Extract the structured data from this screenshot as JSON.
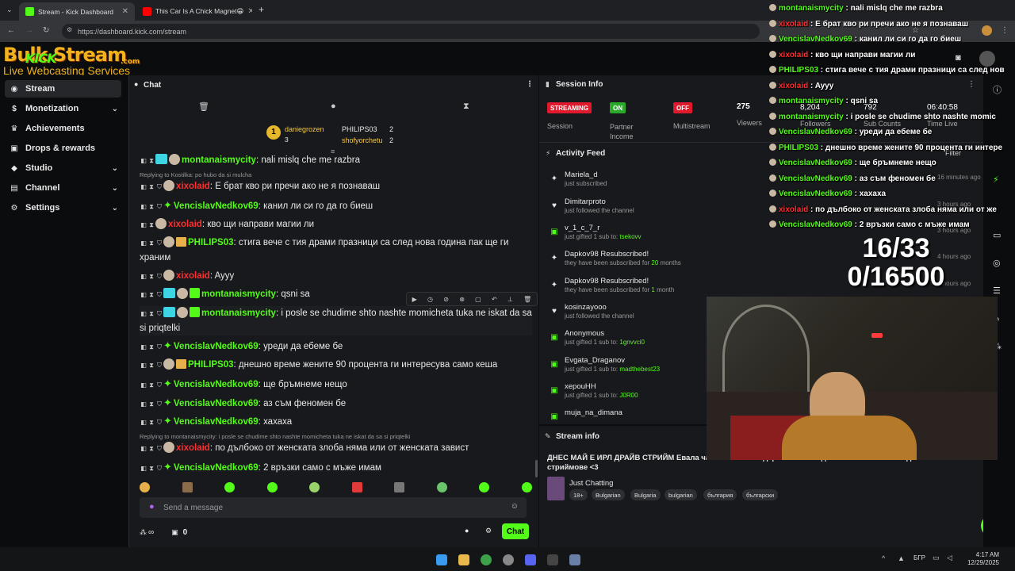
{
  "browser": {
    "tabs": [
      {
        "title": "Stream - Kick Dashboard"
      },
      {
        "title": "This Car Is A Chick Magnet😁"
      }
    ],
    "url": "https://dashboard.kick.com/stream"
  },
  "logo": {
    "text": "Bulk Stream",
    "kick": "KICK",
    "domain": ".com",
    "subtitle": "Live Webcasting Services"
  },
  "sidebar": {
    "items": [
      {
        "label": "Stream"
      },
      {
        "label": "Monetization"
      },
      {
        "label": "Achievements"
      },
      {
        "label": "Drops & rewards"
      },
      {
        "label": "Studio"
      },
      {
        "label": "Channel"
      },
      {
        "label": "Settings"
      }
    ]
  },
  "chat": {
    "title": "Chat",
    "top_gifters": {
      "first": {
        "name": "daniegrozen",
        "count": "3"
      },
      "second": {
        "name": "PHILIPS03",
        "count": "2"
      },
      "third": {
        "name": "shofyorchetu",
        "count": "2"
      },
      "rank": "1"
    },
    "messages": [
      {
        "user": "montanaismycity",
        "text": "nali mislq che me razbra"
      },
      {
        "reply": "Replying to Kostilka: po hubo da si mulcha"
      },
      {
        "user": "xixolaid",
        "text": "Е брат кво ри пречи ако не я познаваш"
      },
      {
        "user": "VencislavNedkov69",
        "text": "канил ли си го да го биеш"
      },
      {
        "user": "xixolaid",
        "text": "кво щи направи магии ли"
      },
      {
        "user": "PHILIPS03",
        "text": "стига вече с тия драми празници са след нова година пак ще ги храним"
      },
      {
        "user": "xixolaid",
        "text": "Ayyy"
      },
      {
        "user": "montanaismycity",
        "text": "qsni sa"
      },
      {
        "user": "montanaismycity",
        "text": "i posle se chudime shto nashte momicheta tuka ne iskat da sa si priqtelki"
      },
      {
        "user": "VencislavNedkov69",
        "text": "уреди да ебеме бе"
      },
      {
        "user": "PHILIPS03",
        "text": "днешно време жените 90 процента ги интересува само кеша"
      },
      {
        "user": "VencislavNedkov69",
        "text": "ще бръмнеме нещо"
      },
      {
        "user": "VencislavNedkov69",
        "text": "аз съм феномен бе"
      },
      {
        "user": "VencislavNedkov69",
        "text": "хахаха"
      },
      {
        "reply": "Replying to montanaismycity: i posle se chudime shto nashte momicheta tuka ne iskat da sa si priqtelki"
      },
      {
        "user": "xixolaid",
        "text": "по дълбоко от женската злоба няма или от женската завист"
      },
      {
        "user": "VencislavNedkov69",
        "text": "2 връзки само с мъже имам"
      }
    ],
    "input_placeholder": "Send a message",
    "footer": {
      "infinity": "∞",
      "count": "0"
    },
    "send_label": "Chat"
  },
  "session": {
    "title": "Session Info",
    "streaming": {
      "status": "STREAMING",
      "label": "Session"
    },
    "partner": {
      "status": "ON",
      "label": "Partner Income"
    },
    "multistream": {
      "status": "OFF",
      "label": "Multistream"
    },
    "viewers": {
      "value": "275",
      "label": "Viewers"
    },
    "followers": {
      "value": "8,204",
      "label": "Followers"
    },
    "subs": {
      "value": "792",
      "label": "Sub Counts"
    },
    "time": {
      "value": "06:40:58",
      "label": "Time Live"
    }
  },
  "activity": {
    "title": "Activity Feed",
    "filter": "Filter",
    "items": [
      {
        "name": "Mariela_d",
        "desc": "just subscribed",
        "time": "16 minutes ago"
      },
      {
        "name": "Dimitarproto",
        "desc": "just followed the channel",
        "time": "3 hours ago"
      },
      {
        "name": "v_1_c_7_r",
        "desc": "just gifted 1 sub to:",
        "target": "tsekovv",
        "time": "3 hours ago"
      },
      {
        "name": "Dapkov98 Resubscribed!",
        "desc": "they have been subscribed for",
        "months": "20",
        "unit": "months",
        "time": "4 hours ago"
      },
      {
        "name": "Dapkov98 Resubscribed!",
        "desc": "they have been subscribed for",
        "months": "1",
        "unit": "month",
        "time": "4 hours ago"
      },
      {
        "name": "kosinzayooo",
        "desc": "just followed the channel",
        "time": ""
      },
      {
        "name": "Anonymous",
        "desc": "just gifted 1 sub to:",
        "target": "1gnvvci0",
        "time": ""
      },
      {
        "name": "Evgata_Draganov",
        "desc": "just gifted 1 sub to:",
        "target": "madthebest23",
        "time": ""
      },
      {
        "name": "xepouHH",
        "desc": "just gifted 1 sub to:",
        "target": "J0R00",
        "time": ""
      },
      {
        "name": "muja_na_dimana",
        "desc": "",
        "time": ""
      }
    ]
  },
  "stream_info": {
    "title": "Stream info",
    "stream_title": "ДНЕС МАЙ Е ИРЛ ДРАЙВ СТРИЙМ Евала ча чата <3 Благодаря на всеки един голове се за всекидневни стриймове <3",
    "category": "Just Chatting",
    "tags": [
      "18+",
      "Bulgarian",
      "Bulgaria",
      "bulgarian",
      "българия",
      "български"
    ]
  },
  "overlay": {
    "lines": [
      {
        "user": "montanaismycity",
        "text": "nali mislq che me razbra",
        "color": "#53fc18"
      },
      {
        "user": "xixolaid",
        "text": "Е брат кво ри пречи ако не я познаваш",
        "color": "#ff2d2d"
      },
      {
        "user": "VencislavNedkov69",
        "text": "канил ли си го да го биеш",
        "color": "#53fc18"
      },
      {
        "user": "xixolaid",
        "text": "кво щи направи магии ли",
        "color": "#ff2d2d"
      },
      {
        "user": "PHILIPS03",
        "text": "стига вече с тия драми празници са след нов",
        "color": "#53fc18"
      },
      {
        "user": "xixolaid",
        "text": "Ayyy",
        "color": "#ff2d2d"
      },
      {
        "user": "montanaismycity",
        "text": "qsni sa",
        "color": "#53fc18"
      },
      {
        "user": "montanaismycity",
        "text": "i posle se chudime shto nashte momic",
        "color": "#53fc18"
      },
      {
        "user": "VencislavNedkov69",
        "text": "уреди да ебеме бе",
        "color": "#53fc18"
      },
      {
        "user": "PHILIPS03",
        "text": "днешно време жените 90 процента ги интерe",
        "color": "#53fc18"
      },
      {
        "user": "VencislavNedkov69",
        "text": "ще бръмнеме нещо",
        "color": "#53fc18"
      },
      {
        "user": "VencislavNedkov69",
        "text": "аз съм феномен бе",
        "color": "#53fc18"
      },
      {
        "user": "VencislavNedkov69",
        "text": "хахаха",
        "color": "#53fc18"
      },
      {
        "user": "xixolaid",
        "text": "по дълбоко от женската злоба няма или от же",
        "color": "#ff2d2d"
      },
      {
        "user": "VencislavNedkov69",
        "text": "2 връзки само с мъже имам",
        "color": "#53fc18"
      }
    ],
    "goal_subs": "16/33",
    "goal_money": "0/16500"
  },
  "taskbar": {
    "lang": "БГР",
    "time": "4:17 AM",
    "date": "12/29/2025"
  },
  "colors": {
    "kick_green": "#53fc18",
    "red": "#ff2d2d",
    "panel": "#18191c",
    "bg": "#0b0c0e"
  }
}
